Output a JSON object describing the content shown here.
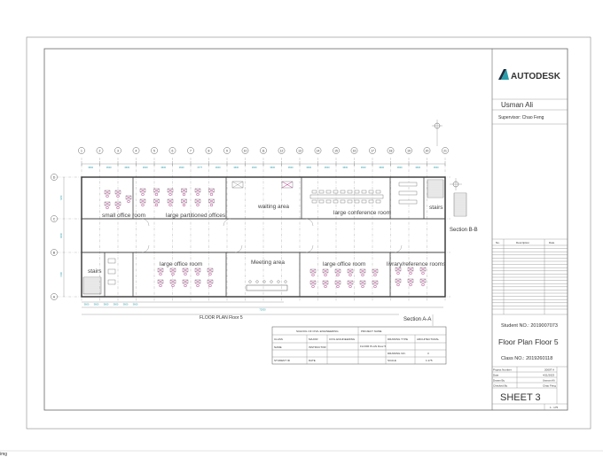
{
  "titleblock": {
    "brand": "AUTODESK",
    "author": "Usman Ali",
    "supervisor": "Supervisor: Chao Feng",
    "revision_headers": [
      "No.",
      "Description",
      "Date"
    ],
    "student_no": "Student NO.: 2019007073",
    "drawing_title": "Floor Plan Floor 5",
    "class_no": "Class NO.: 2019260118",
    "meta": [
      {
        "label": "Project Number",
        "value": "2000T A"
      },
      {
        "label": "Date",
        "value": "4/11/2023"
      },
      {
        "label": "Drawn By",
        "value": "Usman Ali"
      },
      {
        "label": "Checked By",
        "value": "Chao Feng"
      }
    ],
    "sheet": "SHEET 3",
    "scale": "1 : 175"
  },
  "plan": {
    "caption": "FLOOR PLAN Floor 5",
    "section_aa": "Section A-A",
    "section_bb": "Section B-B",
    "column_labels": [
      "1",
      "2",
      "3",
      "4",
      "5",
      "6",
      "7",
      "8",
      "9",
      "10",
      "11",
      "12",
      "13",
      "14",
      "15",
      "16",
      "17",
      "18",
      "19",
      "20",
      "21"
    ],
    "row_labels": [
      "D",
      "C",
      "B",
      "A"
    ],
    "top_dims": [
      "3600",
      "3600",
      "3600",
      "3600",
      "3600",
      "3600",
      "3777",
      "3600",
      "3600",
      "3600",
      "3600",
      "3600",
      "3600",
      "3600",
      "3600",
      "3600",
      "3600",
      "3600",
      "3600",
      "3600"
    ],
    "side_dims": [
      "7200",
      "3000",
      "7200"
    ],
    "bottom_dims": [
      "3600",
      "3600",
      "3600",
      "3600",
      "3600",
      "3600"
    ],
    "bottom_total": "72000",
    "rooms": {
      "small_office": "small office room",
      "partitioned": "large partitioned offices",
      "waiting": "waiting area",
      "conference": "large conference room",
      "stairs_top": "stairs",
      "stairs_bottom": "stairs",
      "large_office_left": "large office room",
      "meeting": "Meeting area",
      "large_office_right": "large office room",
      "library": "livrary/reference rooms"
    }
  },
  "info_table": {
    "school": "SCHOOL OF CIVIL ENGINEERING",
    "project_name": "PROJECT NAME",
    "class": "CLASS",
    "major": "MAJOR",
    "major_value": "CIVIL ENGINEERING",
    "drawing_type": "DRAWING TYPE",
    "drawing_type_value": "ARCHITECTURAL",
    "name": "NAME",
    "instructor": "INSTRUCTOR",
    "floor_plan": "FLOOR PLAN Floor 5",
    "drawing_no": "DRAWING NO.",
    "drawing_no_value": "3",
    "student_id": "STUDENT ID",
    "date": "DATE",
    "scale": "SCALE",
    "scale_value": "1:175"
  },
  "footer_label": "img"
}
